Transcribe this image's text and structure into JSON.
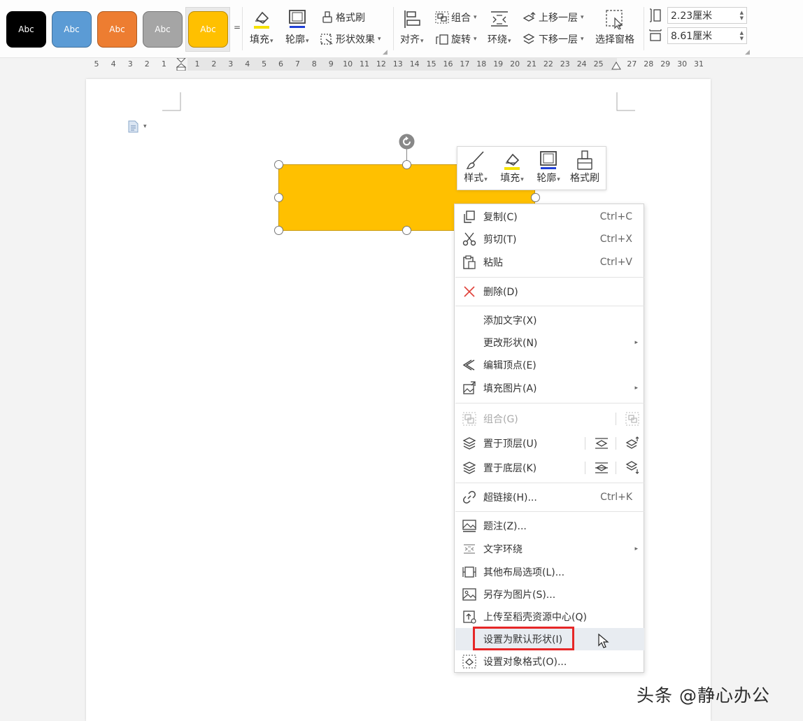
{
  "ribbon": {
    "style_gallery": [
      {
        "label": "Abc",
        "bg": "#000000",
        "fg": "#ffffff",
        "border": "#000000"
      },
      {
        "label": "Abc",
        "bg": "#5b9bd5",
        "fg": "#ffffff",
        "border": "#41719c"
      },
      {
        "label": "Abc",
        "bg": "#ed7d31",
        "fg": "#ffffff",
        "border": "#ae5a21"
      },
      {
        "label": "Abc",
        "bg": "#a5a5a5",
        "fg": "#ffffff",
        "border": "#787878"
      },
      {
        "label": "Abc",
        "bg": "#ffc000",
        "fg": "#ffffff",
        "border": "#bc8c00"
      }
    ],
    "gallery_more": "=",
    "fill": "填充",
    "outline": "轮廓",
    "format_painter": "格式刷",
    "shape_effects": "形状效果",
    "align": "对齐",
    "group": "组合",
    "rotate": "旋转",
    "wrap": "环绕",
    "bring_forward": "上移一层",
    "send_backward": "下移一层",
    "selection_pane": "选择窗格",
    "height_value": "2.23厘米",
    "width_value": "8.61厘米"
  },
  "ruler": {
    "left_ticks": [
      "5",
      "4",
      "3",
      "2",
      "1"
    ],
    "right_ticks": [
      "1",
      "2",
      "3",
      "4",
      "5",
      "6",
      "7",
      "8",
      "9",
      "10",
      "11",
      "12",
      "13",
      "14",
      "15",
      "16",
      "17",
      "18",
      "19",
      "20",
      "21",
      "22",
      "23",
      "24",
      "25",
      "26",
      "27",
      "28",
      "29",
      "30",
      "31"
    ]
  },
  "mini_toolbar": {
    "style": "样式",
    "fill": "填充",
    "outline": "轮廓",
    "format_painter": "格式刷"
  },
  "context_menu": {
    "copy": {
      "label": "复制(C)",
      "shortcut": "Ctrl+C"
    },
    "cut": {
      "label": "剪切(T)",
      "shortcut": "Ctrl+X"
    },
    "paste": {
      "label": "粘贴",
      "shortcut": "Ctrl+V"
    },
    "delete": {
      "label": "删除(D)"
    },
    "add_text": {
      "label": "添加文字(X)"
    },
    "change_shape": {
      "label": "更改形状(N)"
    },
    "edit_points": {
      "label": "编辑顶点(E)"
    },
    "fill_picture": {
      "label": "填充图片(A)"
    },
    "group": {
      "label": "组合(G)"
    },
    "bring_to_front": {
      "label": "置于顶层(U)"
    },
    "send_to_back": {
      "label": "置于底层(K)"
    },
    "hyperlink": {
      "label": "超链接(H)...",
      "shortcut": "Ctrl+K"
    },
    "caption": {
      "label": "题注(Z)..."
    },
    "text_wrap": {
      "label": "文字环绕"
    },
    "more_layout": {
      "label": "其他布局选项(L)..."
    },
    "save_as_picture": {
      "label": "另存为图片(S)..."
    },
    "upload": {
      "label": "上传至稻壳资源中心(Q)"
    },
    "set_default_shape": {
      "label": "设置为默认形状(I)"
    },
    "format_object": {
      "label": "设置对象格式(O)..."
    }
  },
  "colors": {
    "shape_fill": "#ffc000",
    "highlight_border": "#e62727",
    "fill_underline": "#f5e100",
    "outline_underline": "#1f3fd6"
  },
  "watermark": "头条 @静心办公"
}
